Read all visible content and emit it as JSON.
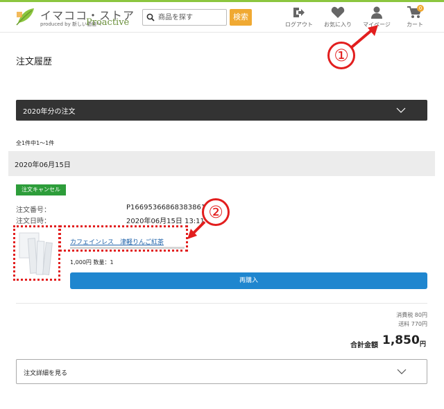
{
  "header": {
    "logo_title": "イマココ・ストア",
    "logo_sub": "produced by 新しい価値へ",
    "logo_brand": "Proactive",
    "search_placeholder": "商品を探す",
    "search_button": "検索",
    "nav": [
      {
        "icon": "logout-icon",
        "label": "ログアウト"
      },
      {
        "icon": "heart-icon",
        "label": "お気に入り"
      },
      {
        "icon": "user-icon",
        "label": "マイページ"
      },
      {
        "icon": "cart-icon",
        "label": "カート",
        "badge": "0"
      }
    ]
  },
  "main": {
    "page_title": "注文履歴",
    "year_dropdown": "2020年分の注文",
    "count_text": "全1件中1〜1件",
    "order": {
      "date": "2020年06月15日",
      "status": "注文キャンセル",
      "number_label": "注文番号：",
      "number_value": "P16695366868383861",
      "datetime_label": "注文日時：",
      "datetime_value": "2020年06月15日 13:11",
      "product_name": "カフェインレス　津軽りんご紅茶",
      "price_qty": "1,000円 数量：1",
      "rebuy_button": "再購入"
    },
    "tax": "消費税 80円",
    "shipping": "送料 770円",
    "total_label": "合計金額",
    "total_value": "1,850",
    "total_unit": "円",
    "details_button": "注文詳細を見る"
  },
  "annotations": {
    "marker_1": "①",
    "marker_2": "②",
    "color": "#e21e1e"
  },
  "colors": {
    "accent_green": "#8cc63f",
    "search_orange": "#f0a932",
    "status_green": "#2d9d3a",
    "button_blue": "#1f86cf",
    "dark_bar": "#333333"
  }
}
